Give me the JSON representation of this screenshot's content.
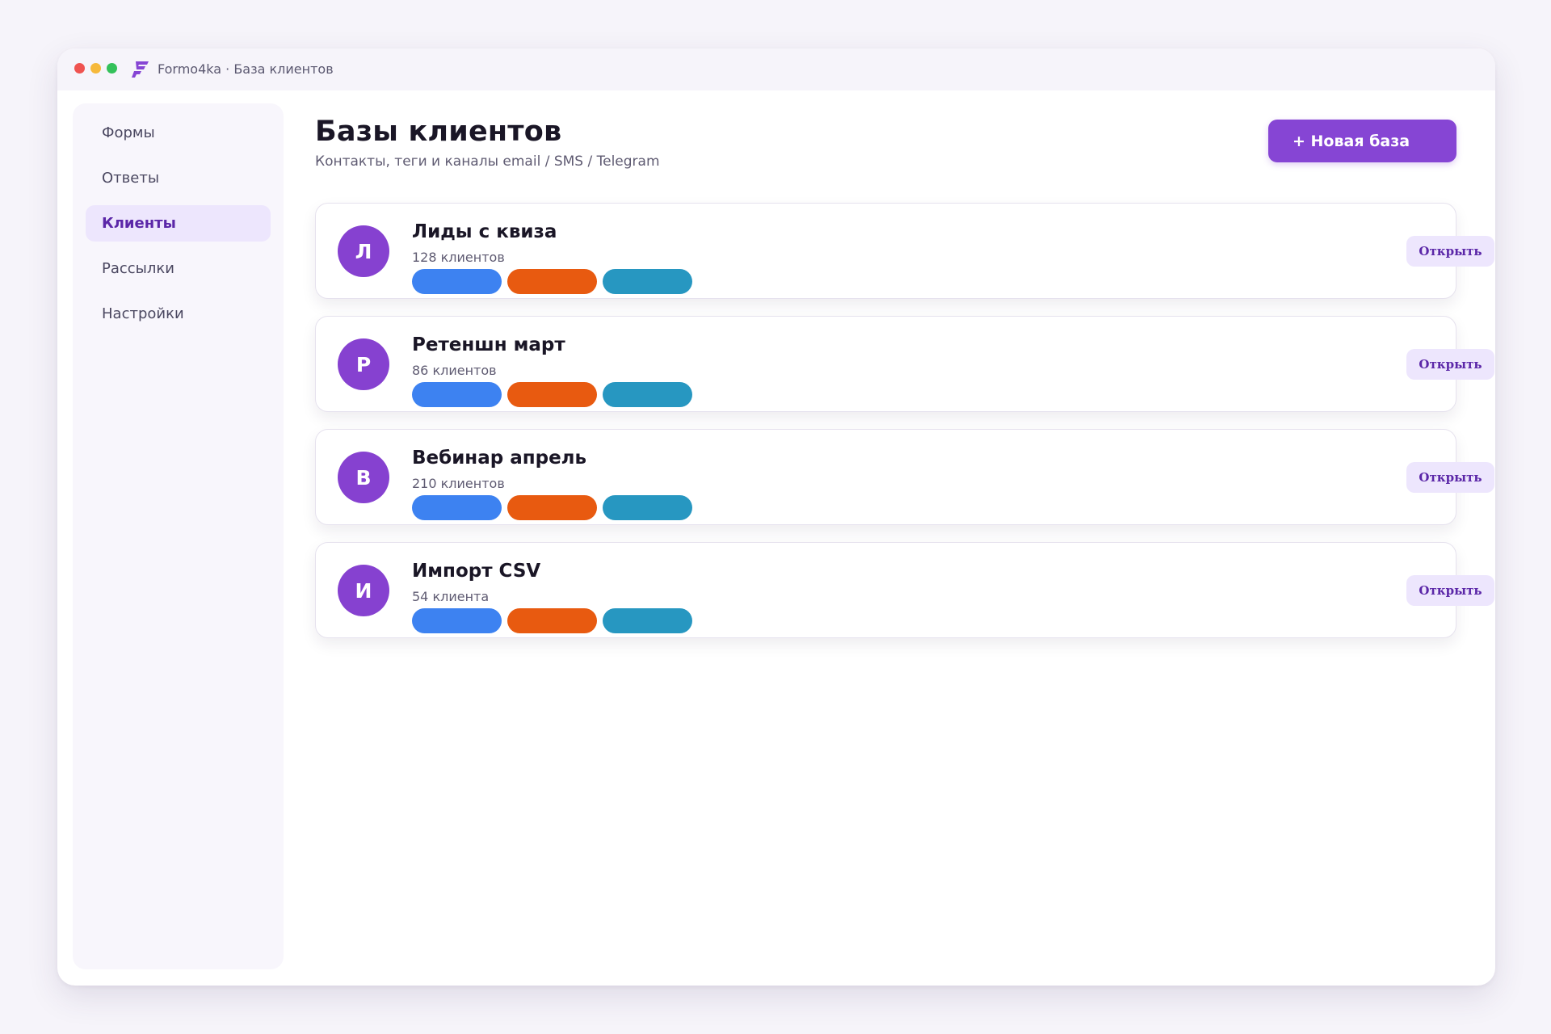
{
  "window": {
    "title": "Formo4ka · База клиентов"
  },
  "sidebar": {
    "items": [
      {
        "label": "Формы",
        "active": false
      },
      {
        "label": "Ответы",
        "active": false
      },
      {
        "label": "Клиенты",
        "active": true
      },
      {
        "label": "Рассылки",
        "active": false
      },
      {
        "label": "Настройки",
        "active": false
      }
    ]
  },
  "header": {
    "title": "Базы клиентов",
    "subtitle": "Контакты, теги и каналы email / SMS / Telegram",
    "new_button_label": "+ Новая база"
  },
  "bases": [
    {
      "initial": "Л",
      "name": "Лиды с квиза",
      "count": "128 клиентов",
      "open_label": "Открыть"
    },
    {
      "initial": "Р",
      "name": "Ретеншн март",
      "count": "86 клиентов",
      "open_label": "Открыть"
    },
    {
      "initial": "В",
      "name": "Вебинар апрель",
      "count": "210 клиентов",
      "open_label": "Открыть"
    },
    {
      "initial": "И",
      "name": "Импорт CSV",
      "count": "54 клиента",
      "open_label": "Открыть"
    }
  ],
  "colors": {
    "accent": "#8645d4",
    "channel_email": "#3d82f1",
    "channel_sms": "#e85a10",
    "channel_telegram": "#2797c1"
  }
}
